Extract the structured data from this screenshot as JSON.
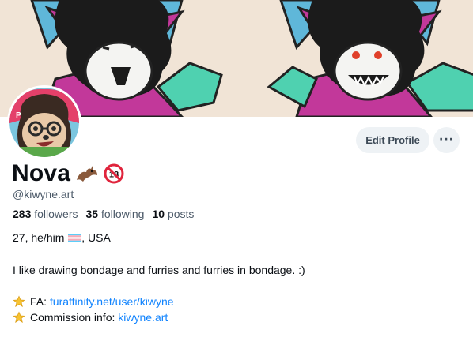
{
  "profile": {
    "display_name": "Nova",
    "handle": "@kiwyne.art",
    "name_icons": [
      "bat-icon",
      "no-18-icon"
    ]
  },
  "actions": {
    "edit_profile_label": "Edit Profile",
    "more_label": "···"
  },
  "stats": {
    "followers_count": "283",
    "followers_label": "followers",
    "following_count": "35",
    "following_label": "following",
    "posts_count": "10",
    "posts_label": "posts"
  },
  "bio": {
    "age_pronouns": "27, he/him",
    "location_suffix": ", USA",
    "description": "I like drawing bondage and furries and furries in bondage. :)",
    "links": [
      {
        "icon": "star-icon",
        "label": "FA:",
        "url_text": "furaffinity.net/user/kiwyne"
      },
      {
        "icon": "star-icon",
        "label": "Commission info:",
        "url_text": "kiwyne.art"
      }
    ]
  },
  "colors": {
    "link": "#1083fe",
    "muted_text": "#4b5968",
    "button_bg": "#eef2f5"
  }
}
